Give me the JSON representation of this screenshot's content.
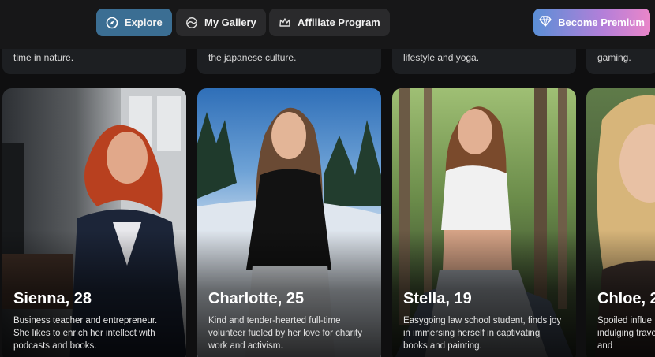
{
  "nav": {
    "explore": "Explore",
    "gallery": "My Gallery",
    "affiliate": "Affiliate Program",
    "premium": "Become Premium"
  },
  "prev_row": [
    "time in nature.",
    "the japanese culture.",
    "lifestyle and yoga.",
    "gaming."
  ],
  "cards": [
    {
      "name": "Sienna, 28",
      "desc": "Business teacher and entrepreneur. She likes to enrich her intellect with podcasts and books."
    },
    {
      "name": "Charlotte, 25",
      "desc": "Kind and tender-hearted full-time volunteer fueled by her love for charity work and activism."
    },
    {
      "name": "Stella, 19",
      "desc": "Easygoing law school student, finds joy in immersing herself in captivating books and painting."
    },
    {
      "name": "Chloe, 2",
      "desc": "Spoiled influe life indulging traveling and"
    }
  ],
  "icons": {
    "explore": "compass-icon",
    "gallery": "gallery-icon",
    "affiliate": "crown-icon",
    "premium": "diamond-icon"
  },
  "colors": {
    "explore_active": "#3b6e93",
    "premium_start": "#5b8fd6",
    "premium_end": "#ea86c9"
  }
}
